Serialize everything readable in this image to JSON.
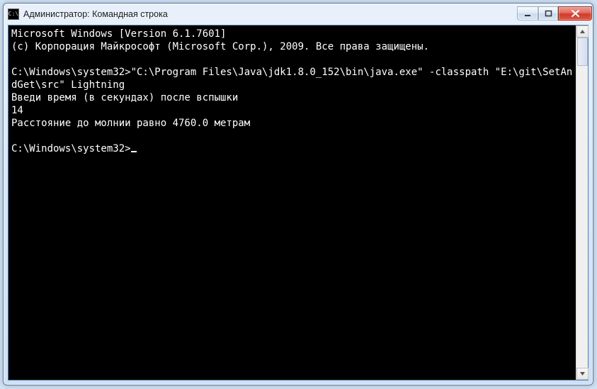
{
  "window": {
    "title": "Администратор: Командная строка",
    "icon_glyph": "C:\\"
  },
  "console": {
    "lines": [
      "Microsoft Windows [Version 6.1.7601]",
      "(c) Корпорация Майкрософт (Microsoft Corp.), 2009. Все права защищены.",
      "",
      "C:\\Windows\\system32>\"C:\\Program Files\\Java\\jdk1.8.0_152\\bin\\java.exe\" -classpath \"E:\\git\\SetAndGet\\src\" Lightning",
      "Введи время (в секундах) после вспышки",
      "14",
      "Расстояние до молнии равно 4760.0 метрам",
      "",
      "C:\\Windows\\system32>"
    ]
  }
}
